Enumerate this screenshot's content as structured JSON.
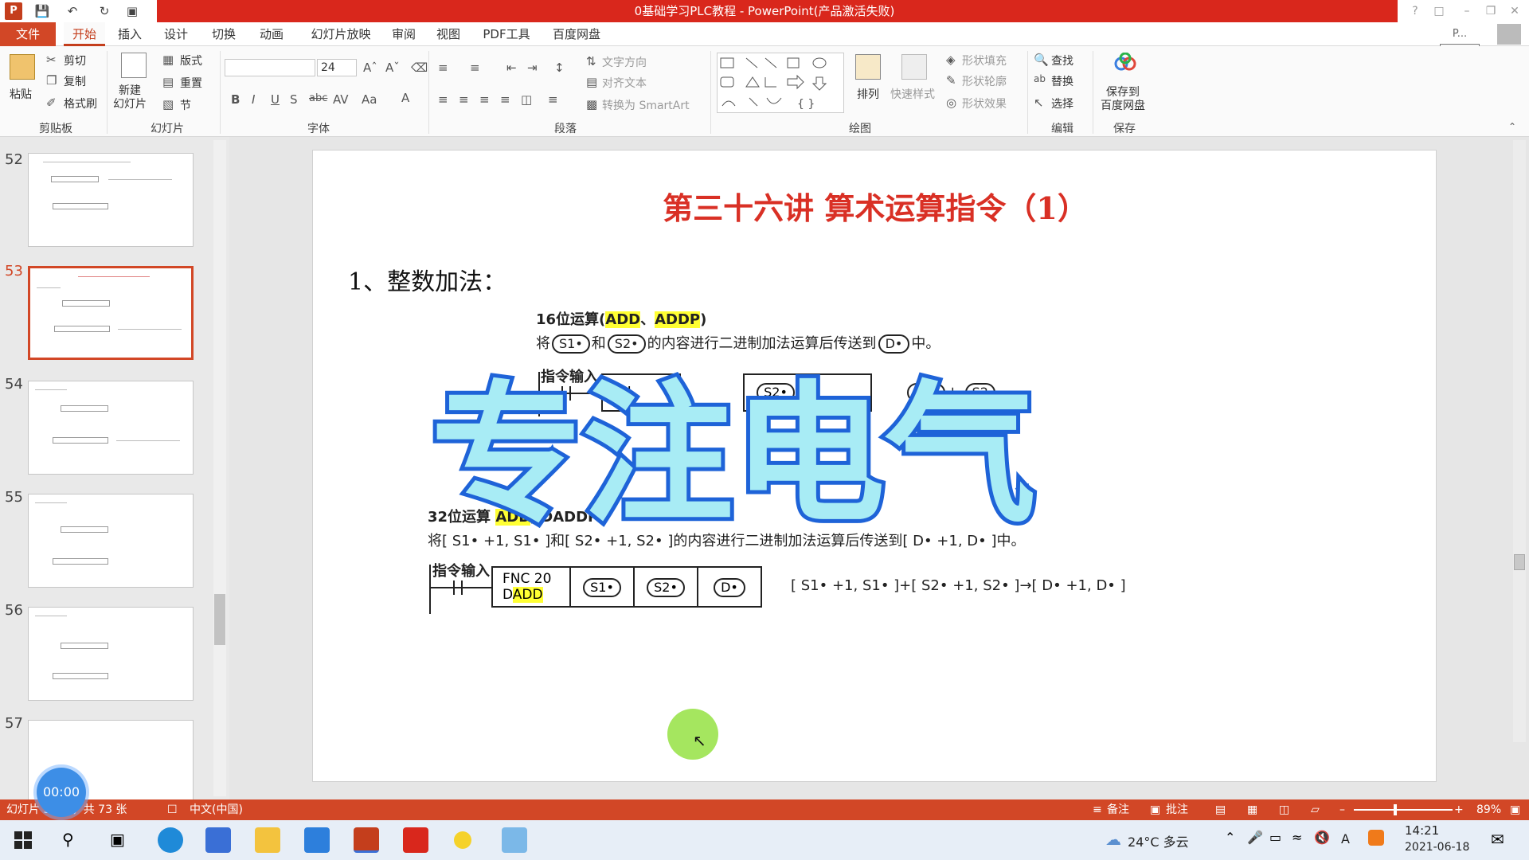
{
  "window": {
    "title": "0基础学习PLC教程 - PowerPoint(产品激活失败)",
    "search_tooltip": "开始",
    "user_label": "P..."
  },
  "tabs": [
    {
      "label": "文件"
    },
    {
      "label": "开始"
    },
    {
      "label": "插入"
    },
    {
      "label": "设计"
    },
    {
      "label": "切换"
    },
    {
      "label": "动画"
    },
    {
      "label": "幻灯片放映"
    },
    {
      "label": "审阅"
    },
    {
      "label": "视图"
    },
    {
      "label": "PDF工具"
    },
    {
      "label": "百度网盘"
    }
  ],
  "ribbon": {
    "clipboard": {
      "paste": "粘贴",
      "cut": "剪切",
      "copy": "复制",
      "format_painter": "格式刷",
      "label": "剪贴板"
    },
    "slides": {
      "new_slide": "新建\n幻灯片",
      "layout": "版式",
      "reset": "重置",
      "section": "节",
      "label": "幻灯片"
    },
    "font": {
      "size": "24",
      "label": "字体"
    },
    "paragraph": {
      "text_direction": "文字方向",
      "align_text": "对齐文本",
      "smartart": "转换为 SmartArt",
      "label": "段落"
    },
    "drawing": {
      "arrange": "排列",
      "quick_styles": "快速样式",
      "shape_fill": "形状填充",
      "shape_outline": "形状轮廓",
      "shape_effects": "形状效果",
      "label": "绘图"
    },
    "editing": {
      "find": "查找",
      "replace": "替换",
      "select": "选择",
      "label": "编辑"
    },
    "save": {
      "save_to_baidu": "保存到\n百度网盘",
      "label": "保存"
    }
  },
  "thumbnails": [
    {
      "num": "52"
    },
    {
      "num": "53"
    },
    {
      "num": "54"
    },
    {
      "num": "55"
    },
    {
      "num": "56"
    },
    {
      "num": "57"
    }
  ],
  "slide": {
    "title": "第三十六讲  算术运算指令（1）",
    "heading": "1、整数加法：",
    "sec16": {
      "title_prefix": "16位运算(",
      "title_hl1": "ADD",
      "title_sep": "、",
      "title_hl2": "ADDP",
      "title_suffix": ")",
      "desc_a": "将",
      "s1": "S1•",
      "desc_and": "和",
      "s2": "S2•",
      "desc_b": "的内容进行二进制加法运算后传送到",
      "d": "D•",
      "desc_end": "中。",
      "input": "指令输入",
      "fnc": "FN",
      "plus": "+",
      "s2_short": "S2"
    },
    "sec32": {
      "title_prefix": "32位运算",
      "title_hl1": "ADD",
      "title_rest": ", DADDP)",
      "desc": "将[ S1• +1, S1• ]和[ S2• +1, S2• ]的内容进行二进制加法运算后传送到[ D• +1, D• ]中。",
      "input": "指令输入",
      "fnc_line1": "FNC 20",
      "fnc_line2_d": "D",
      "fnc_line2_hl": "ADD",
      "s1": "S1•",
      "s2": "S2•",
      "d": "D•",
      "formula": "[ S1• +1, S1• ]+[ S2• +1, S2• ]→[ D• +1, D• ]"
    },
    "watermark": "专注电气"
  },
  "status": {
    "slide_info": "幻灯片 53 张，共 73 张",
    "language": "中文(中国)",
    "notes": "备注",
    "comments": "批注",
    "zoom": "89%"
  },
  "timer": "00:00",
  "taskbar": {
    "weather": "24°C 多云",
    "time": "14:21",
    "date": "2021-06-18",
    "ime": "A"
  }
}
